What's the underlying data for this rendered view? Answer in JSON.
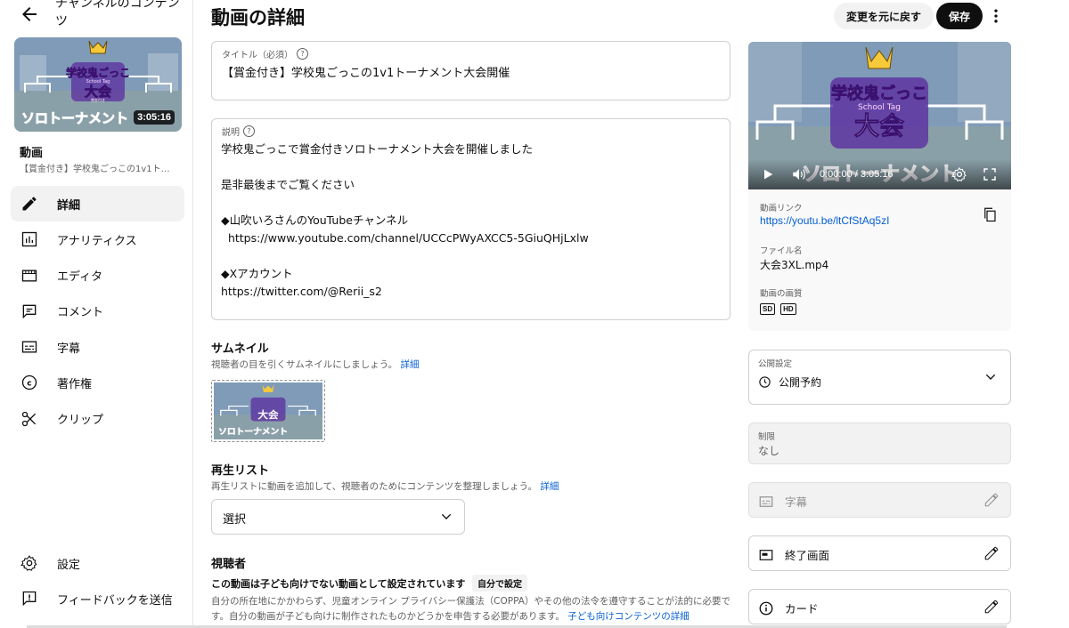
{
  "sidebar": {
    "channel_title": "チャンネルのコンテンツ",
    "thumb_duration": "3:05:16",
    "video_label": "動画",
    "video_title": "【賞金付き】学校鬼ごっこの1v1トーナメント大会開催",
    "items": [
      {
        "label": "詳細",
        "icon": "pencil-icon"
      },
      {
        "label": "アナリティクス",
        "icon": "analytics-icon"
      },
      {
        "label": "エディタ",
        "icon": "editor-icon"
      },
      {
        "label": "コメント",
        "icon": "comment-icon"
      },
      {
        "label": "字幕",
        "icon": "subtitles-icon"
      },
      {
        "label": "著作権",
        "icon": "copyright-icon"
      },
      {
        "label": "クリップ",
        "icon": "scissors-icon"
      }
    ],
    "bottom": [
      {
        "label": "設定",
        "icon": "gear-icon"
      },
      {
        "label": "フィードバックを送信",
        "icon": "feedback-icon"
      }
    ]
  },
  "header": {
    "title": "動画の詳細",
    "undo_label": "変更を元に戻す",
    "save_label": "保存"
  },
  "form": {
    "title_label": "タイトル（必須）",
    "title_value": "【賞金付き】学校鬼ごっこの1v1トーナメント大会開催",
    "desc_label": "説明",
    "desc_value": "学校鬼ごっこで賞金付きソロトーナメント大会を開催しました\n\n是非最後までご覧ください\n\n◆山吹いろさんのYouTubeチャンネル\n  https://www.youtube.com/channel/UCCcPWyAXCC5-5GiuQHjLxlw\n\n◆Xアカウント\nhttps://twitter.com/@Rerii_s2",
    "thumbnail_heading": "サムネイル",
    "thumbnail_sub": "視聴者の目を引くサムネイルにしましょう。",
    "thumbnail_link": "詳細",
    "playlist_heading": "再生リスト",
    "playlist_sub": "再生リストに動画を追加して、視聴者のためにコンテンツを整理しましょう。",
    "playlist_link": "詳細",
    "playlist_value": "選択",
    "audience_heading": "視聴者",
    "audience_bold": "この動画は子ども向けでない動画として設定されています",
    "audience_badge": "自分で設定",
    "audience_text": "自分の所在地にかかわらず、児童オンライン プライバシー保護法（COPPA）やその他の法令を遵守することが法的に必要です。自分の動画が子ども向けに制作されたものかどうかを申告する必要があります。",
    "audience_link": "子ども向けコンテンツの詳細"
  },
  "thumbnail_art": {
    "line1": "学校鬼ごっこ",
    "line2": "School Tag",
    "line3": "大会",
    "line4": "賞金付き",
    "line5": "ソロトーナメント"
  },
  "preview": {
    "time": "0:00:00 / 3:05:16",
    "link_label": "動画リンク",
    "link_value": "https://youtu.be/ltCfStAq5zI",
    "file_label": "ファイル名",
    "file_value": "大会3XL.mp4",
    "quality_label": "動画の画質",
    "quality": [
      "SD",
      "HD"
    ]
  },
  "right": {
    "visibility_label": "公開設定",
    "visibility_value": "公開予約",
    "restriction_label": "制限",
    "restriction_value": "なし",
    "subtitles_label": "字幕",
    "endscreen_label": "終了画面",
    "cards_label": "カード"
  },
  "colors": {
    "accent_link": "#065fd4",
    "save_bg": "#0f0f0f",
    "thumb_purple": "#7b2fd0"
  }
}
